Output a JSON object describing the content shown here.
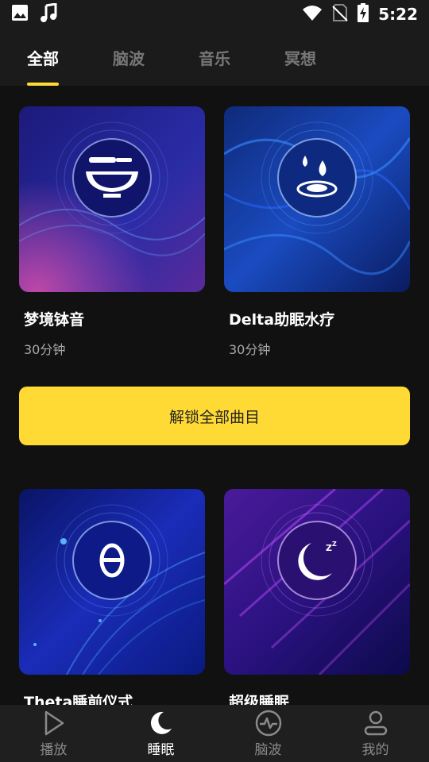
{
  "status_bar": {
    "time": "5:22",
    "icons": [
      "image-icon",
      "music-note-icon",
      "wifi-icon",
      "no-sim-icon",
      "battery-charging-icon"
    ]
  },
  "tabs": [
    {
      "label": "全部",
      "active": true
    },
    {
      "label": "脑波",
      "active": false
    },
    {
      "label": "音乐",
      "active": false
    },
    {
      "label": "冥想",
      "active": false
    }
  ],
  "tracks": [
    {
      "title": "梦境钵音",
      "duration": "30分钟",
      "icon": "singing-bowl-icon",
      "accent": "#3a2aa8"
    },
    {
      "title": "Delta助眠水疗",
      "duration": "30分钟",
      "icon": "water-drops-icon",
      "accent": "#1f50c8"
    },
    {
      "title": "Theta睡前仪式",
      "duration": "",
      "icon": "theta-icon",
      "accent": "#1a2fb0"
    },
    {
      "title": "超级睡眠",
      "duration": "",
      "icon": "moon-zzz-icon",
      "accent": "#5a1aa8"
    }
  ],
  "unlock_button": {
    "label": "解锁全部曲目"
  },
  "bottom_nav": [
    {
      "label": "播放",
      "icon": "play-icon",
      "active": false
    },
    {
      "label": "睡眠",
      "icon": "moon-icon",
      "active": true
    },
    {
      "label": "脑波",
      "icon": "pulse-icon",
      "active": false
    },
    {
      "label": "我的",
      "icon": "user-icon",
      "active": false
    }
  ],
  "colors": {
    "accent": "#ffda34",
    "background": "#111111",
    "bar": "#1b1b1b"
  }
}
